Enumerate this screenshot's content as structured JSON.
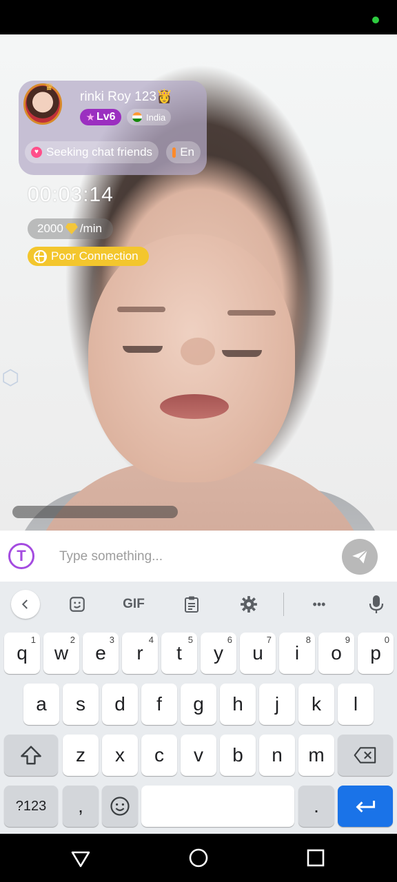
{
  "status_bar": {
    "indicator_color": "#2ecc40"
  },
  "profile": {
    "name": "rinki Roy 123👸",
    "level": "Lv6",
    "country": "India",
    "tags": [
      "Seeking chat friends",
      "En"
    ]
  },
  "call": {
    "timer": "00:03:14",
    "price_amount": "2000",
    "price_unit": "/min",
    "connection_status": "Poor Connection"
  },
  "input": {
    "placeholder": "Type something...",
    "app_icon_letter": "T"
  },
  "keyboard": {
    "toolbar": {
      "gif_label": "GIF",
      "more_label": "•••"
    },
    "row1": [
      {
        "k": "q",
        "h": "1"
      },
      {
        "k": "w",
        "h": "2"
      },
      {
        "k": "e",
        "h": "3"
      },
      {
        "k": "r",
        "h": "4"
      },
      {
        "k": "t",
        "h": "5"
      },
      {
        "k": "y",
        "h": "6"
      },
      {
        "k": "u",
        "h": "7"
      },
      {
        "k": "i",
        "h": "8"
      },
      {
        "k": "o",
        "h": "9"
      },
      {
        "k": "p",
        "h": "0"
      }
    ],
    "row2": [
      "a",
      "s",
      "d",
      "f",
      "g",
      "h",
      "j",
      "k",
      "l"
    ],
    "row3": [
      "z",
      "x",
      "c",
      "v",
      "b",
      "n",
      "m"
    ],
    "symbols_label": "?123",
    "comma_label": ",",
    "period_label": ".",
    "enter_color": "#1a73e8"
  }
}
